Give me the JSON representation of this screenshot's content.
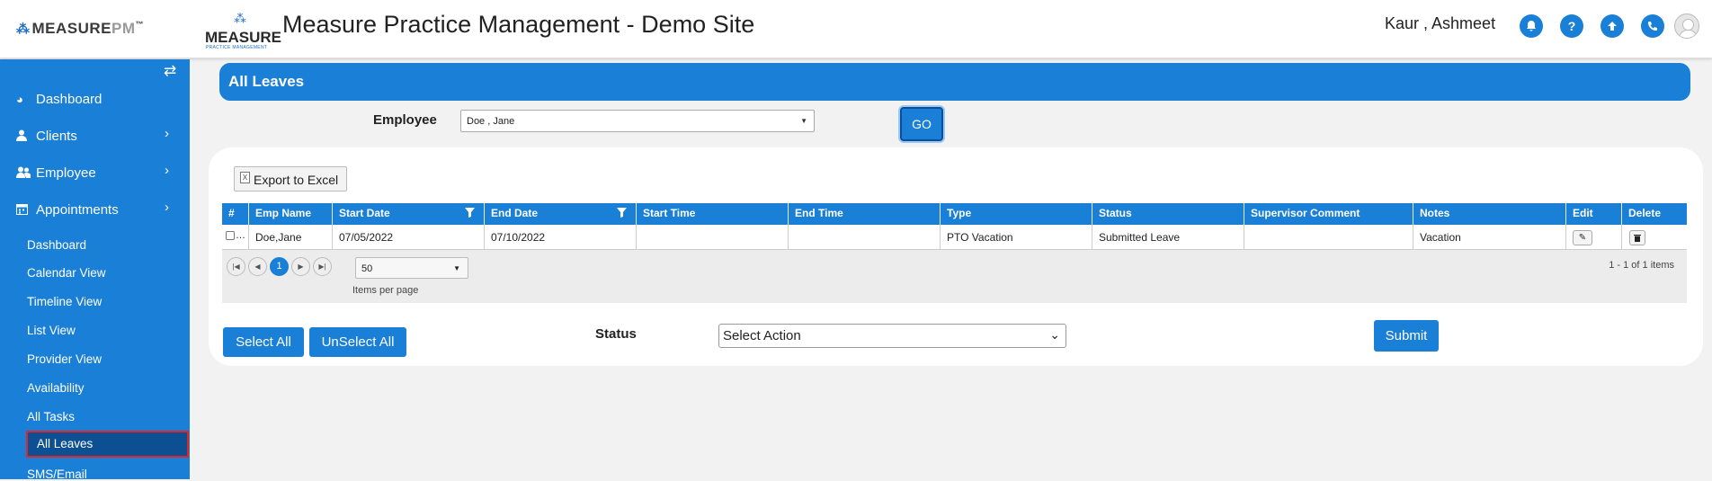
{
  "header": {
    "brand_logo": {
      "left": "MEASURE",
      "right": "PM",
      "trademark": "™"
    },
    "practice_logo": {
      "name": "MEASURE",
      "subtitle": "PRACTICE MANAGEMENT"
    },
    "title": "Measure Practice Management - Demo Site",
    "user_name": "Kaur , Ashmeet",
    "icons": [
      "bell-icon",
      "help-icon",
      "upload-icon",
      "phone-icon",
      "user-avatar-icon"
    ]
  },
  "sidebar": {
    "toggle_icon": "⇄",
    "items": [
      {
        "label": "Dashboard",
        "icon": "dashboard-icon",
        "glyph": "◕",
        "has_submenu": false
      },
      {
        "label": "Clients",
        "icon": "user-icon",
        "glyph": "👤",
        "has_submenu": true
      },
      {
        "label": "Employee",
        "icon": "users-icon",
        "glyph": "👥",
        "has_submenu": true
      },
      {
        "label": "Appointments",
        "icon": "calendar-icon",
        "glyph": "▦",
        "has_submenu": true
      }
    ],
    "chevron": "›",
    "subitems": [
      "Dashboard",
      "Calendar View",
      "Timeline View",
      "List View",
      "Provider View",
      "Availability",
      "All Tasks",
      "All Leaves",
      "SMS/Email"
    ],
    "active_subitem": "All Leaves"
  },
  "main": {
    "banner_title": "All Leaves",
    "employee_label": "Employee",
    "employee_value": "Doe , Jane",
    "go_label": "GO",
    "export_label": "Export to Excel",
    "grid": {
      "columns": [
        "#",
        "Emp Name",
        "Start Date",
        "End Date",
        "Start Time",
        "End Time",
        "Type",
        "Status",
        "Supervisor Comment",
        "Notes",
        "Edit",
        "Delete"
      ],
      "filter_columns": [
        "Start Date",
        "End Date"
      ],
      "rows": [
        {
          "emp_name": "Doe,Jane",
          "start_date": "07/05/2022",
          "end_date": "07/10/2022",
          "start_time": "",
          "end_time": "",
          "type": "PTO Vacation",
          "status": "Submitted Leave",
          "supervisor_comment": "",
          "notes": "Vacation"
        }
      ]
    },
    "pager": {
      "current_page": "1",
      "page_size": "50",
      "items_per_page_label": "Items per page",
      "info": "1 - 1 of 1 items"
    },
    "select_all_label": "Select All",
    "unselect_all_label": "UnSelect All",
    "status_label": "Status",
    "action_select_value": "Select Action",
    "submit_label": "Submit"
  },
  "colors": {
    "primary": "#1a7fd6",
    "active_nav": "#0d4f93",
    "highlight_border": "#e0262a"
  }
}
